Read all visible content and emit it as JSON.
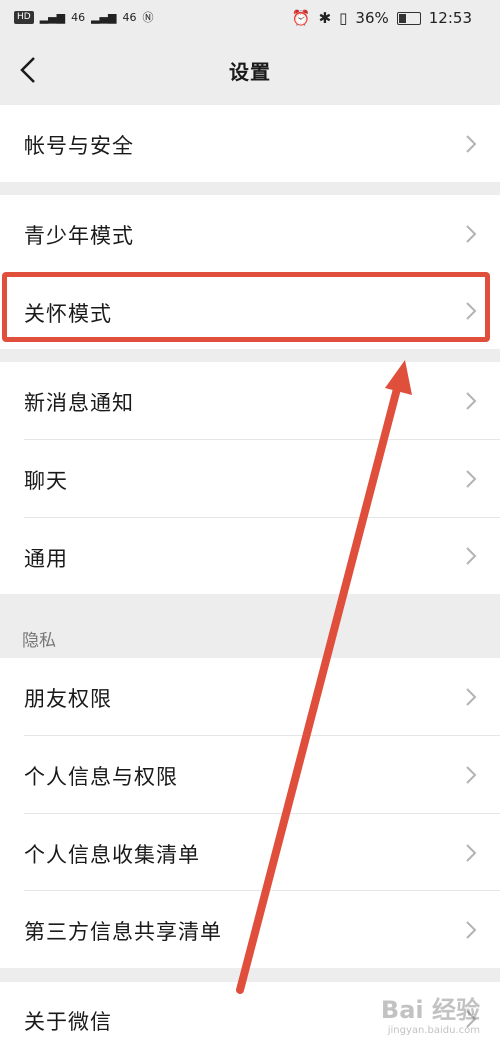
{
  "status_bar": {
    "carrier_left": "HD",
    "signal1": "46",
    "signal2": "46",
    "battery_pct": "36%",
    "time": "12:53"
  },
  "nav": {
    "title": "设置"
  },
  "items": [
    {
      "label": "帐号与安全"
    },
    {
      "label": "青少年模式"
    },
    {
      "label": "关怀模式"
    },
    {
      "label": "新消息通知"
    },
    {
      "label": "聊天"
    },
    {
      "label": "通用"
    },
    {
      "label": "朋友权限"
    },
    {
      "label": "个人信息与权限"
    },
    {
      "label": "个人信息收集清单"
    },
    {
      "label": "第三方信息共享清单"
    },
    {
      "label": "关于微信"
    }
  ],
  "sections": {
    "privacy": "隐私"
  },
  "watermark": {
    "brand": "Bai 经验",
    "url": "jingyan.baidu.com"
  },
  "colors": {
    "background": "#ededed",
    "cell": "#ffffff",
    "highlight": "#e04e3c",
    "chevron": "#b3b3b3"
  }
}
